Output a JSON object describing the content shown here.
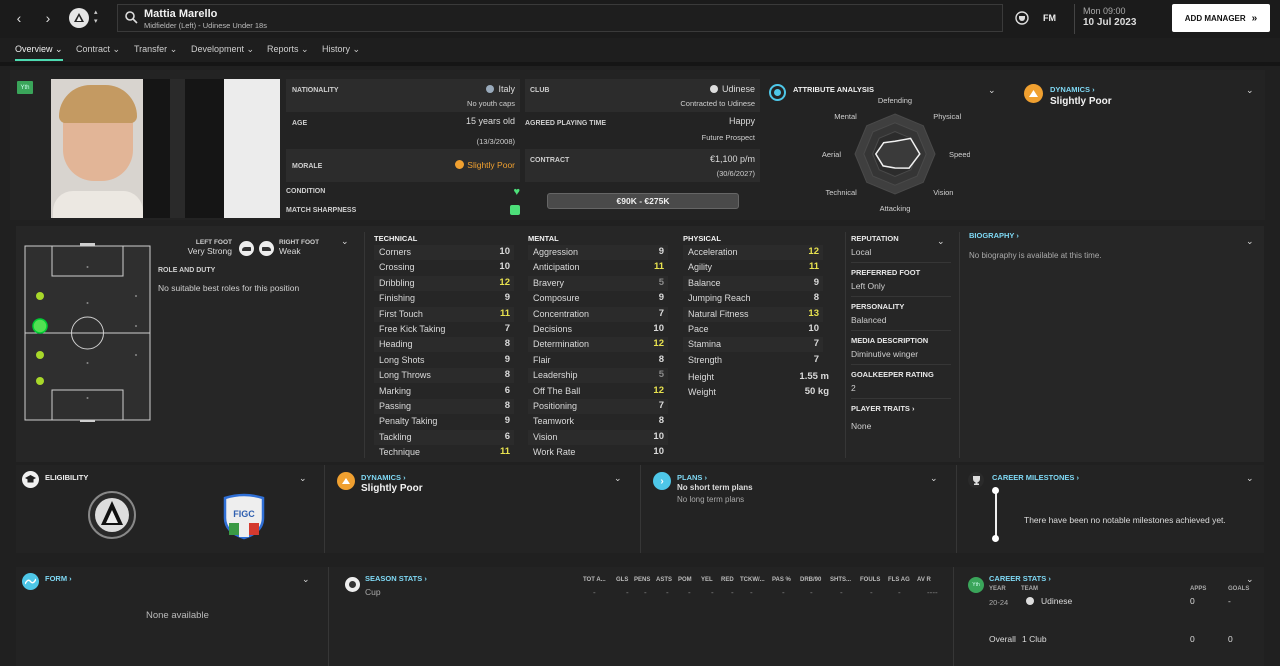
{
  "header": {
    "player_name": "Mattia Marello",
    "player_desc": "Midfielder (Left) - Udinese Under 18s",
    "fm_label": "FM",
    "date_time": "Mon 09:00",
    "date": "10 Jul 2023",
    "add_manager": "ADD MANAGER"
  },
  "tabs": [
    {
      "label": "Overview"
    },
    {
      "label": "Contract"
    },
    {
      "label": "Transfer"
    },
    {
      "label": "Development"
    },
    {
      "label": "Reports"
    },
    {
      "label": "History"
    }
  ],
  "badge": "Yth",
  "profile": {
    "nationality_label": "NATIONALITY",
    "nationality": "Italy",
    "youth_caps": "No youth caps",
    "age_label": "AGE",
    "age": "15 years old",
    "dob": "(13/3/2008)",
    "morale_label": "MORALE",
    "morale": "Slightly Poor",
    "condition_label": "CONDITION",
    "sharpness_label": "MATCH SHARPNESS",
    "club_label": "CLUB",
    "club": "Udinese",
    "contracted": "Contracted to Udinese",
    "playing_time_label": "AGREED PLAYING TIME",
    "playing_time": "Happy",
    "prospect": "Future Prospect",
    "contract_label": "CONTRACT",
    "wage": "€1,100 p/m",
    "contract_end": "(30/6/2027)",
    "value": "€90K - €275K"
  },
  "attribute_analysis": {
    "title": "ATTRIBUTE ANALYSIS",
    "labels": [
      "Defending",
      "Physical",
      "Speed",
      "Vision",
      "Attacking",
      "Technical",
      "Aerial",
      "Mental"
    ],
    "levels": [
      0.32,
      0.55,
      0.62,
      0.5,
      0.35,
      0.42,
      0.48,
      0.4
    ]
  },
  "dynamics_top": {
    "title": "DYNAMICS",
    "value": "Slightly Poor"
  },
  "feet": {
    "left_label": "LEFT FOOT",
    "left_value": "Very Strong",
    "right_label": "RIGHT FOOT",
    "right_value": "Weak"
  },
  "role": {
    "title": "ROLE AND DUTY",
    "text": "No suitable best roles for this position"
  },
  "technical": {
    "title": "TECHNICAL",
    "items": [
      {
        "name": "Corners",
        "value": "10"
      },
      {
        "name": "Crossing",
        "value": "10"
      },
      {
        "name": "Dribbling",
        "value": "12"
      },
      {
        "name": "Finishing",
        "value": "9"
      },
      {
        "name": "First Touch",
        "value": "11"
      },
      {
        "name": "Free Kick Taking",
        "value": "7"
      },
      {
        "name": "Heading",
        "value": "8"
      },
      {
        "name": "Long Shots",
        "value": "9"
      },
      {
        "name": "Long Throws",
        "value": "8"
      },
      {
        "name": "Marking",
        "value": "6"
      },
      {
        "name": "Passing",
        "value": "8"
      },
      {
        "name": "Penalty Taking",
        "value": "9"
      },
      {
        "name": "Tackling",
        "value": "6"
      },
      {
        "name": "Technique",
        "value": "11"
      }
    ]
  },
  "mental": {
    "title": "MENTAL",
    "items": [
      {
        "name": "Aggression",
        "value": "9"
      },
      {
        "name": "Anticipation",
        "value": "11"
      },
      {
        "name": "Bravery",
        "value": "5"
      },
      {
        "name": "Composure",
        "value": "9"
      },
      {
        "name": "Concentration",
        "value": "7"
      },
      {
        "name": "Decisions",
        "value": "10"
      },
      {
        "name": "Determination",
        "value": "12"
      },
      {
        "name": "Flair",
        "value": "8"
      },
      {
        "name": "Leadership",
        "value": "5"
      },
      {
        "name": "Off The Ball",
        "value": "12"
      },
      {
        "name": "Positioning",
        "value": "7"
      },
      {
        "name": "Teamwork",
        "value": "8"
      },
      {
        "name": "Vision",
        "value": "10"
      },
      {
        "name": "Work Rate",
        "value": "10"
      }
    ]
  },
  "physical": {
    "title": "PHYSICAL",
    "items": [
      {
        "name": "Acceleration",
        "value": "12"
      },
      {
        "name": "Agility",
        "value": "11"
      },
      {
        "name": "Balance",
        "value": "9"
      },
      {
        "name": "Jumping Reach",
        "value": "8"
      },
      {
        "name": "Natural Fitness",
        "value": "13"
      },
      {
        "name": "Pace",
        "value": "10"
      },
      {
        "name": "Stamina",
        "value": "7"
      },
      {
        "name": "Strength",
        "value": "7"
      }
    ],
    "height_label": "Height",
    "height": "1.55 m",
    "weight_label": "Weight",
    "weight": "50 kg"
  },
  "info": {
    "reputation_label": "REPUTATION",
    "reputation": "Local",
    "foot_label": "PREFERRED FOOT",
    "foot": "Left Only",
    "personality_label": "PERSONALITY",
    "personality": "Balanced",
    "media_label": "MEDIA DESCRIPTION",
    "media": "Diminutive winger",
    "gk_label": "GOALKEEPER RATING",
    "gk": "2",
    "traits_label": "PLAYER TRAITS",
    "traits": "None"
  },
  "biography": {
    "title": "BIOGRAPHY",
    "text": "No biography is available at this time."
  },
  "eligibility": {
    "title": "ELIGIBILITY",
    "federation": "FIGC"
  },
  "dynamics_mid": {
    "title": "DYNAMICS",
    "value": "Slightly Poor"
  },
  "plans": {
    "title": "PLANS",
    "short": "No short term plans",
    "long": "No long term plans"
  },
  "milestones": {
    "title": "CAREER MILESTONES",
    "text": "There have been no notable milestones achieved yet."
  },
  "form": {
    "title": "FORM",
    "text": "None available"
  },
  "season_stats": {
    "title": "SEASON STATS",
    "columns": [
      "TOT A...",
      "GLS",
      "PENS",
      "ASTS",
      "POM",
      "YEL",
      "RED",
      "TCKW/...",
      "PAS %",
      "DRB/90",
      "SHTS...",
      "FOULS",
      "FLS AG",
      "AV R"
    ],
    "row_label": "Cup",
    "dashes": [
      "-",
      "-",
      "-",
      "-",
      "-",
      "-",
      "-",
      "-",
      "-",
      "-",
      "-",
      "-",
      "-",
      "----"
    ]
  },
  "career_stats": {
    "title": "CAREER STATS",
    "year_h": "YEAR",
    "team_h": "TEAM",
    "apps_h": "APPS",
    "goals_h": "GOALS",
    "year": "20-24",
    "team": "Udinese",
    "apps": "0",
    "goals": "-",
    "overall": "Overall",
    "clubs": "1 Club",
    "total_apps": "0",
    "total_goals": "0"
  },
  "colors": {
    "accent": "#4dd9b0",
    "highlight": "#e8e24f",
    "dynamics": "#f0a030",
    "link": "#7fd9f5"
  }
}
